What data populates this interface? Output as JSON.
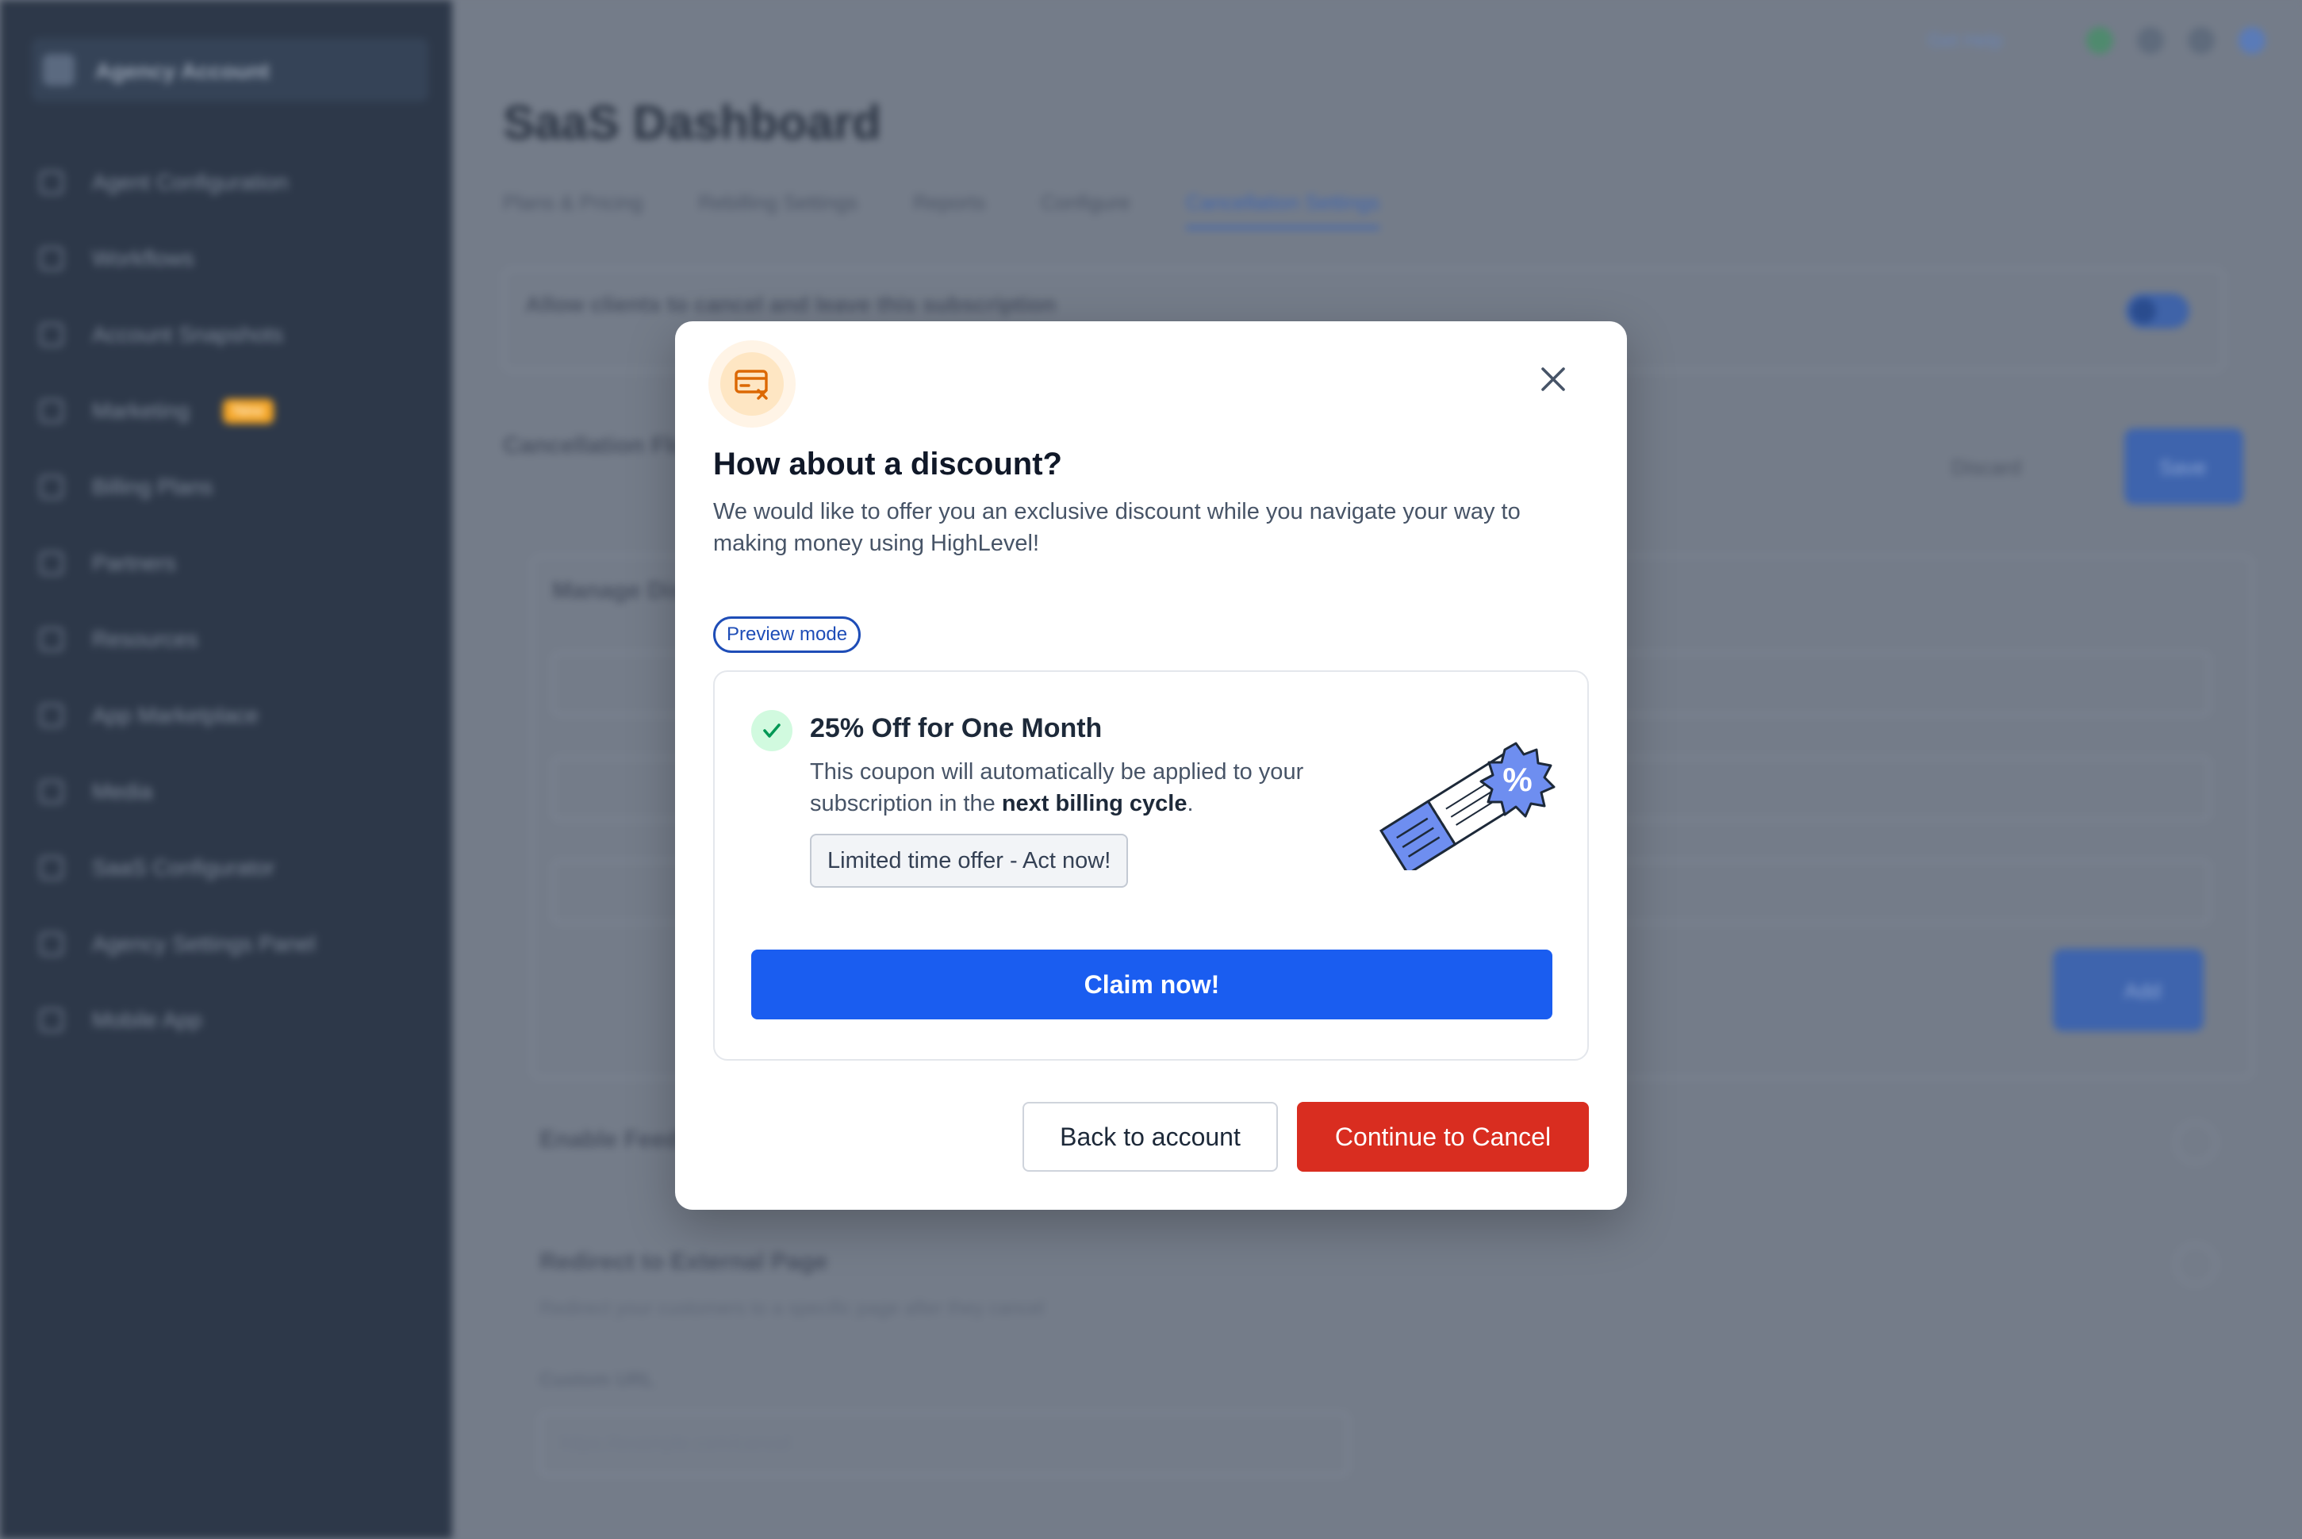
{
  "background": {
    "brand": "Agency Account",
    "sidebar_items": [
      {
        "label": "Agent Configuration"
      },
      {
        "label": "Workflows"
      },
      {
        "label": "Account Snapshots"
      },
      {
        "label": "Marketing",
        "badge": "New"
      },
      {
        "label": "Billing Plans"
      },
      {
        "label": "Partners"
      },
      {
        "label": "Resources"
      },
      {
        "label": "App Marketplace"
      },
      {
        "label": "Media"
      },
      {
        "label": "SaaS Configurator"
      },
      {
        "label": "Agency Settings Panel"
      },
      {
        "label": "Mobile App"
      }
    ],
    "page_title": "SaaS Dashboard",
    "tabs": [
      "Plans & Pricing",
      "Rebilling Settings",
      "Reports",
      "Configure",
      "Cancellation Settings"
    ],
    "topbar_link": "Get Help",
    "section_toggle_text": "Allow clients to cancel and leave this subscription",
    "cancellation_heading": "Cancellation Flow",
    "manage_heading": "Manage Discounts",
    "enable_heading": "Enable Feedback",
    "redirect_heading": "Redirect to External Page",
    "redirect_sub": "Redirect your customers to a specific page after they cancel",
    "custom_url_label": "Custom URL",
    "custom_url_placeholder": "https://example.com/cancel",
    "discard_label": "Discard",
    "save_label": "Save",
    "add_label": "Add"
  },
  "modal": {
    "title": "How about a discount?",
    "description": "We would like to offer you an exclusive discount while you navigate your way to making money using HighLevel!",
    "preview_pill": "Preview mode",
    "offer": {
      "title": "25% Off for One Month",
      "desc_prefix": "This coupon will automatically be applied to your subscription in the ",
      "desc_bold": "next billing cycle",
      "desc_suffix": ".",
      "tag": "Limited time offer - Act now!",
      "claim_label": "Claim now!"
    },
    "back_label": "Back to account",
    "continue_label": "Continue to Cancel"
  },
  "colors": {
    "primary": "#1a5df0",
    "danger": "#d92d20",
    "overlay": "#747c89",
    "sidebar": "#2d3849"
  }
}
